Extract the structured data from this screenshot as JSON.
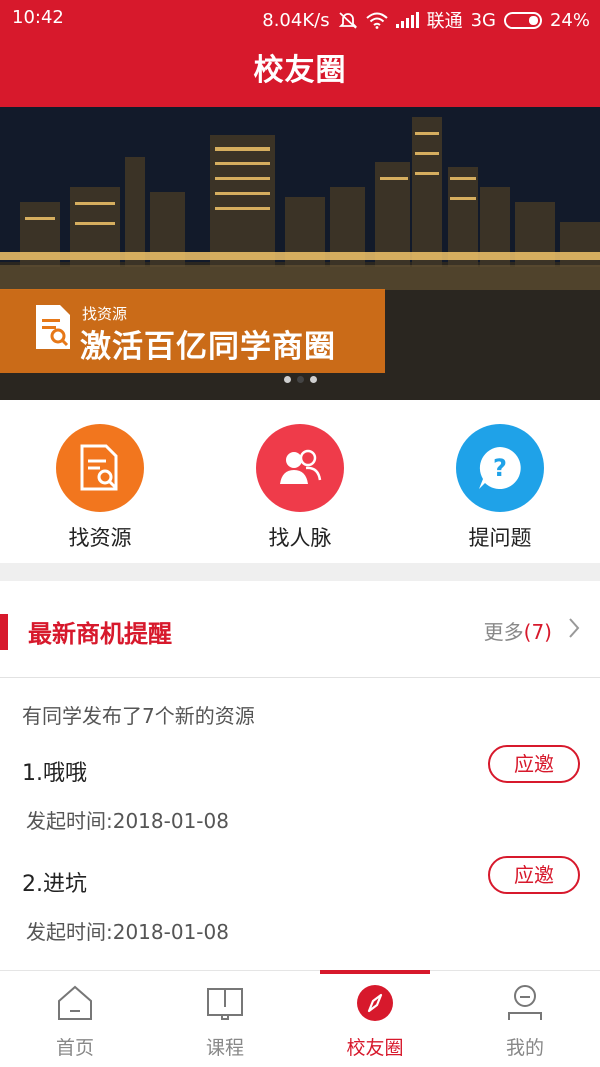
{
  "status": {
    "time": "10:42",
    "network_speed": "8.04K/s",
    "carrier": "联通",
    "network_type": "3G",
    "battery": "24%"
  },
  "header": {
    "title": "校友圈"
  },
  "banner": {
    "tag": "找资源",
    "headline": "激活百亿同学商圈",
    "page_count": 3,
    "active_page": 2
  },
  "quick_actions": [
    {
      "label": "找资源",
      "icon": "find-resource-icon",
      "color": "#f2761e"
    },
    {
      "label": "找人脉",
      "icon": "contacts-icon",
      "color": "#ef3b4a"
    },
    {
      "label": "提问题",
      "icon": "question-icon",
      "color": "#1fa2e8"
    }
  ],
  "section": {
    "title": "最新商机提醒",
    "more_label": "更多",
    "more_count": "(7)"
  },
  "summary": "有同学发布了7个新的资源",
  "items": [
    {
      "name": "1.哦哦",
      "time": "发起时间:2018-01-08",
      "action": "应邀"
    },
    {
      "name": "2.进坑",
      "time": "发起时间:2018-01-08",
      "action": "应邀"
    }
  ],
  "tabs": [
    {
      "label": "首页",
      "icon": "home-icon"
    },
    {
      "label": "课程",
      "icon": "book-icon"
    },
    {
      "label": "校友圈",
      "icon": "compass-icon",
      "active": true
    },
    {
      "label": "我的",
      "icon": "profile-icon"
    }
  ],
  "colors": {
    "brand": "#d7192c",
    "banner_label": "#e67818"
  }
}
